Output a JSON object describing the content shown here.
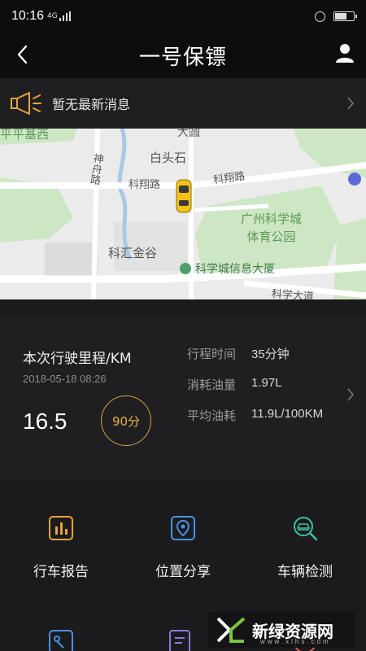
{
  "status_bar": {
    "time": "10:16",
    "network": "4G"
  },
  "header": {
    "title": "一号保镖"
  },
  "notice": {
    "message": "暂无最新消息"
  },
  "map": {
    "labels": {
      "place_top_left": "平平基西",
      "place_top": "大圆",
      "place_baishitou": "白头石",
      "road_shenzhou": "神舟路",
      "road_kexiang_1": "科翔路",
      "road_kexiang_2": "科翔路",
      "park": "广州科学城\n体育公园",
      "place_kehui": "科汇金谷",
      "building": "科学城信息大厦",
      "road_kexue": "科学大道"
    }
  },
  "trip": {
    "title": "本次行驶里程/KM",
    "date": "2018-05-18 08:26",
    "distance": "16.5",
    "score": "90分",
    "stats": [
      {
        "label": "行程时间",
        "value": "35分钟"
      },
      {
        "label": "消耗油量",
        "value": "1.97L"
      },
      {
        "label": "平均油耗",
        "value": "11.9L/100KM"
      }
    ]
  },
  "features": [
    {
      "label": "行车报告",
      "icon": "report-chart-icon"
    },
    {
      "label": "位置分享",
      "icon": "location-pin-icon"
    },
    {
      "label": "车辆检测",
      "icon": "car-inspect-icon"
    }
  ],
  "watermark": {
    "text": "新绿资源网",
    "sub": "www.xlhs.com"
  },
  "colors": {
    "accent_gold": "#e8a33a",
    "accent_blue": "#4a90e2",
    "accent_green": "#3fc1a5",
    "bg": "#1b1b1e"
  }
}
